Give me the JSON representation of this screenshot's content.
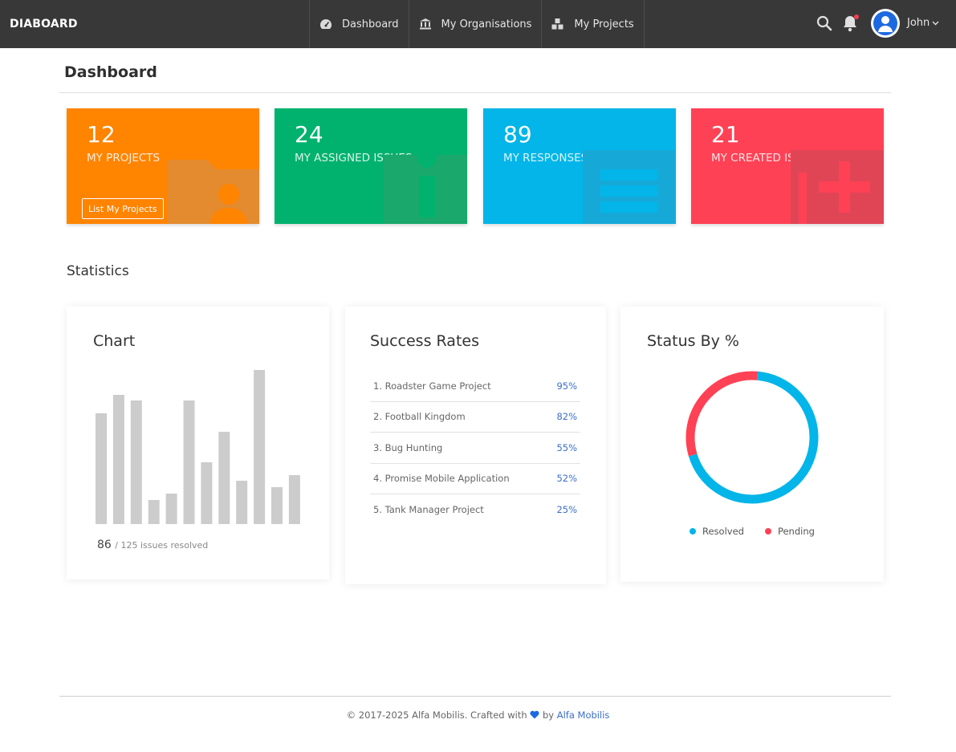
{
  "navbar": {
    "brand": "DIABOARD",
    "links": [
      {
        "label": "Dashboard",
        "icon": "dashboard-gauge-icon"
      },
      {
        "label": "My Organisations",
        "icon": "bank-building-icon"
      },
      {
        "label": "My Projects",
        "icon": "boxes-icon"
      }
    ],
    "user_name": "John",
    "icons": [
      "search-icon",
      "bell-icon",
      "user-avatar-icon",
      "chevron-down-icon"
    ],
    "notification_dot_color": "#f0404f"
  },
  "page": {
    "title": "Dashboard"
  },
  "tiles": [
    {
      "value": "12",
      "label": "MY PROJECTS",
      "color": "#ff8400",
      "button": "List My Projects",
      "icon": "folder-user-icon"
    },
    {
      "value": "24",
      "label": "MY ASSIGNED ISSUES",
      "color": "#00b26e",
      "icon": "info-icon"
    },
    {
      "value": "89",
      "label": "MY RESPONSES",
      "color": "#03b5e8",
      "icon": "list-lines-icon"
    },
    {
      "value": "21",
      "label": "MY CREATED ISSUES",
      "color": "#ff4155",
      "icon": "exclamation-plus-icon"
    }
  ],
  "statistics": {
    "title": "Statistics",
    "chart_card": {
      "title": "Chart",
      "resolved": "86",
      "total_text": "/ 125 issues resolved"
    },
    "success_card": {
      "title": "Success Rates",
      "rows": [
        {
          "name": "1. Roadster Game Project",
          "value": "95%"
        },
        {
          "name": "2. Football Kingdom",
          "value": "82%"
        },
        {
          "name": "3. Bug Hunting",
          "value": "55%"
        },
        {
          "name": "4. Promise Mobile Application",
          "value": "52%"
        },
        {
          "name": "5. Tank Manager Project",
          "value": "25%"
        }
      ]
    },
    "status_card": {
      "title": "Status By %",
      "legend": [
        {
          "label": "Resolved",
          "color": "#03b5e8"
        },
        {
          "label": "Pending",
          "color": "#ff4155"
        }
      ]
    }
  },
  "chart_data": [
    {
      "type": "bar",
      "values": [
        138,
        161,
        154,
        30,
        38,
        154,
        77,
        115,
        54,
        192,
        46,
        61
      ],
      "ylim": [
        0,
        192
      ],
      "color": "#cccccc",
      "grid": false
    },
    {
      "type": "pie",
      "donut": true,
      "labels": [
        "Resolved",
        "Pending"
      ],
      "values": [
        69,
        31
      ],
      "colors": [
        "#03b5e8",
        "#ff4155"
      ]
    }
  ],
  "footer": {
    "text": "© 2017-2025 Alfa Mobilis. Crafted with",
    "by": "by",
    "link": "Alfa Mobilis",
    "heart_color": "#1d6ae0"
  }
}
